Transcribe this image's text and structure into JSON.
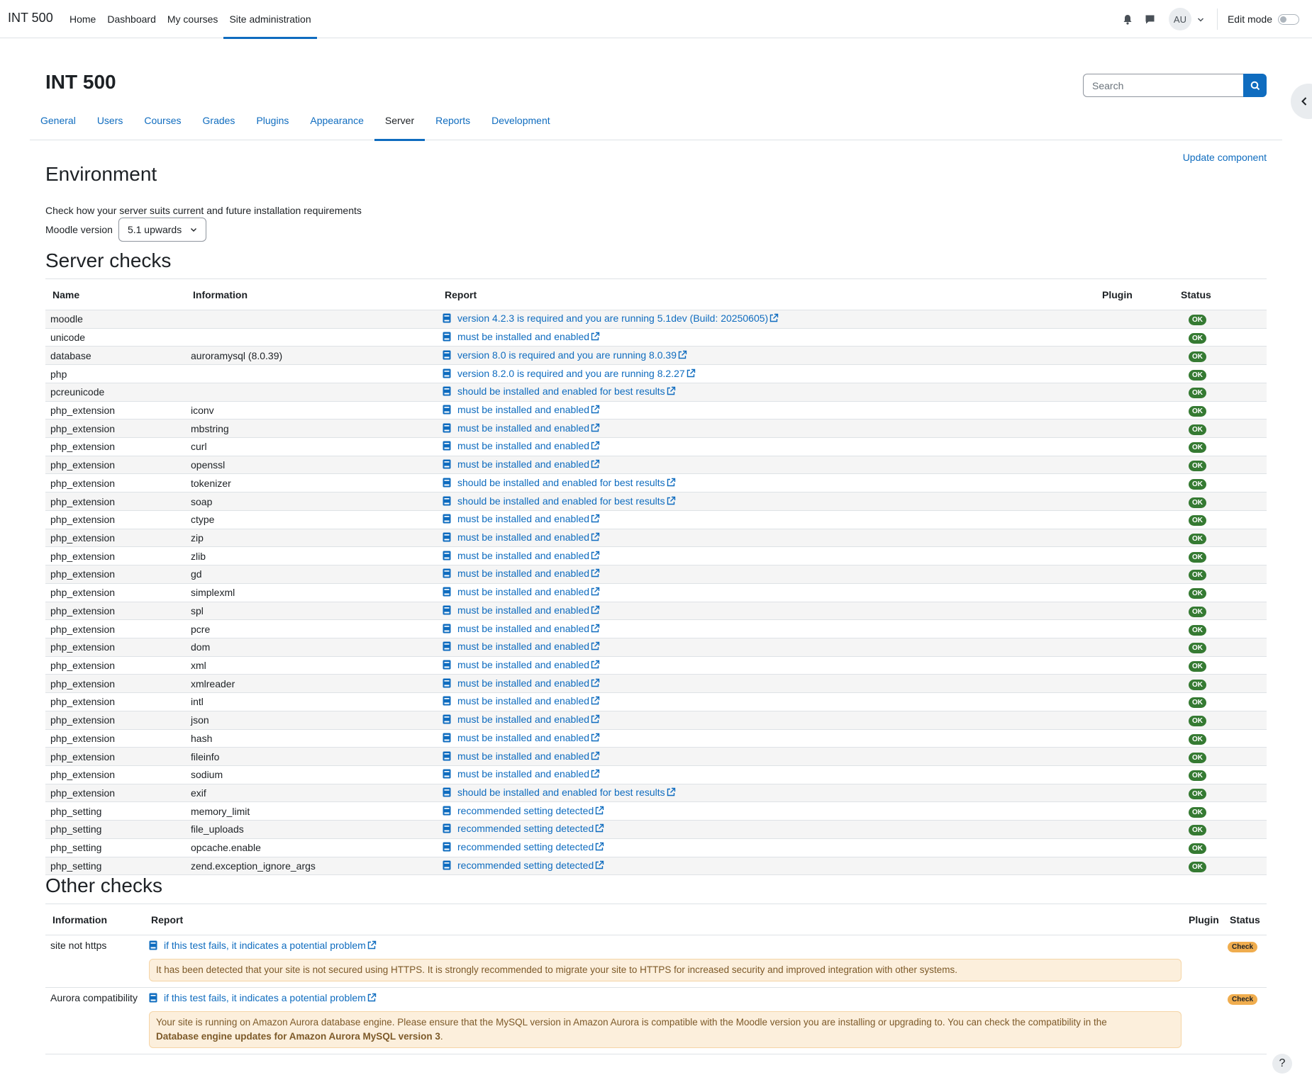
{
  "brand": "INT 500",
  "primary_nav": [
    "Home",
    "Dashboard",
    "My courses",
    "Site administration"
  ],
  "user_initials": "AU",
  "edit_mode_label": "Edit mode",
  "page_title": "INT 500",
  "search": {
    "placeholder": "Search"
  },
  "secondary_nav": [
    "General",
    "Users",
    "Courses",
    "Grades",
    "Plugins",
    "Appearance",
    "Server",
    "Reports",
    "Development"
  ],
  "active_secondary": "Server",
  "update_component": "Update component",
  "environment": {
    "heading": "Environment",
    "description": "Check how your server suits current and future installation requirements",
    "version_label": "Moodle version",
    "version_value": "5.1 upwards"
  },
  "server_checks": {
    "heading": "Server checks",
    "columns": [
      "Name",
      "Information",
      "Report",
      "Plugin",
      "Status"
    ],
    "rows": [
      {
        "name": "moodle",
        "info": "",
        "report": "version 4.2.3 is required and you are running 5.1dev (Build: 20250605)",
        "plugin": "",
        "status": "OK"
      },
      {
        "name": "unicode",
        "info": "",
        "report": "must be installed and enabled",
        "plugin": "",
        "status": "OK"
      },
      {
        "name": "database",
        "info": "auroramysql (8.0.39)",
        "report": "version 8.0 is required and you are running 8.0.39",
        "plugin": "",
        "status": "OK"
      },
      {
        "name": "php",
        "info": "",
        "report": "version 8.2.0 is required and you are running 8.2.27",
        "plugin": "",
        "status": "OK"
      },
      {
        "name": "pcreunicode",
        "info": "",
        "report": "should be installed and enabled for best results",
        "plugin": "",
        "status": "OK"
      },
      {
        "name": "php_extension",
        "info": "iconv",
        "report": "must be installed and enabled",
        "plugin": "",
        "status": "OK"
      },
      {
        "name": "php_extension",
        "info": "mbstring",
        "report": "must be installed and enabled",
        "plugin": "",
        "status": "OK"
      },
      {
        "name": "php_extension",
        "info": "curl",
        "report": "must be installed and enabled",
        "plugin": "",
        "status": "OK"
      },
      {
        "name": "php_extension",
        "info": "openssl",
        "report": "must be installed and enabled",
        "plugin": "",
        "status": "OK"
      },
      {
        "name": "php_extension",
        "info": "tokenizer",
        "report": "should be installed and enabled for best results",
        "plugin": "",
        "status": "OK"
      },
      {
        "name": "php_extension",
        "info": "soap",
        "report": "should be installed and enabled for best results",
        "plugin": "",
        "status": "OK"
      },
      {
        "name": "php_extension",
        "info": "ctype",
        "report": "must be installed and enabled",
        "plugin": "",
        "status": "OK"
      },
      {
        "name": "php_extension",
        "info": "zip",
        "report": "must be installed and enabled",
        "plugin": "",
        "status": "OK"
      },
      {
        "name": "php_extension",
        "info": "zlib",
        "report": "must be installed and enabled",
        "plugin": "",
        "status": "OK"
      },
      {
        "name": "php_extension",
        "info": "gd",
        "report": "must be installed and enabled",
        "plugin": "",
        "status": "OK"
      },
      {
        "name": "php_extension",
        "info": "simplexml",
        "report": "must be installed and enabled",
        "plugin": "",
        "status": "OK"
      },
      {
        "name": "php_extension",
        "info": "spl",
        "report": "must be installed and enabled",
        "plugin": "",
        "status": "OK"
      },
      {
        "name": "php_extension",
        "info": "pcre",
        "report": "must be installed and enabled",
        "plugin": "",
        "status": "OK"
      },
      {
        "name": "php_extension",
        "info": "dom",
        "report": "must be installed and enabled",
        "plugin": "",
        "status": "OK"
      },
      {
        "name": "php_extension",
        "info": "xml",
        "report": "must be installed and enabled",
        "plugin": "",
        "status": "OK"
      },
      {
        "name": "php_extension",
        "info": "xmlreader",
        "report": "must be installed and enabled",
        "plugin": "",
        "status": "OK"
      },
      {
        "name": "php_extension",
        "info": "intl",
        "report": "must be installed and enabled",
        "plugin": "",
        "status": "OK"
      },
      {
        "name": "php_extension",
        "info": "json",
        "report": "must be installed and enabled",
        "plugin": "",
        "status": "OK"
      },
      {
        "name": "php_extension",
        "info": "hash",
        "report": "must be installed and enabled",
        "plugin": "",
        "status": "OK"
      },
      {
        "name": "php_extension",
        "info": "fileinfo",
        "report": "must be installed and enabled",
        "plugin": "",
        "status": "OK"
      },
      {
        "name": "php_extension",
        "info": "sodium",
        "report": "must be installed and enabled",
        "plugin": "",
        "status": "OK"
      },
      {
        "name": "php_extension",
        "info": "exif",
        "report": "should be installed and enabled for best results",
        "plugin": "",
        "status": "OK"
      },
      {
        "name": "php_setting",
        "info": "memory_limit",
        "report": "recommended setting detected",
        "plugin": "",
        "status": "OK"
      },
      {
        "name": "php_setting",
        "info": "file_uploads",
        "report": "recommended setting detected",
        "plugin": "",
        "status": "OK"
      },
      {
        "name": "php_setting",
        "info": "opcache.enable",
        "report": "recommended setting detected",
        "plugin": "",
        "status": "OK"
      },
      {
        "name": "php_setting",
        "info": "zend.exception_ignore_args",
        "report": "recommended setting detected",
        "plugin": "",
        "status": "OK"
      }
    ]
  },
  "other_checks": {
    "heading": "Other checks",
    "columns": [
      "Information",
      "Report",
      "Plugin",
      "Status"
    ],
    "rows": [
      {
        "info": "site not https",
        "report": "if this test fails, it indicates a potential problem",
        "alert": "It has been detected that your site is not secured using HTTPS. It is strongly recommended to migrate your site to HTTPS for increased security and improved integration with other systems.",
        "alert_bold": "",
        "alert_tail": "",
        "status": "Check"
      },
      {
        "info": "Aurora compatibility",
        "report": "if this test fails, it indicates a potential problem",
        "alert": "Your site is running on Amazon Aurora database engine. Please ensure that the MySQL version in Amazon Aurora is compatible with the Moodle version you are installing or upgrading to. You can check the compatibility in the",
        "alert_bold": "Database engine updates for Amazon Aurora MySQL version 3",
        "alert_tail": ".",
        "status": "Check"
      }
    ]
  },
  "help_label": "?",
  "colors": {
    "accent": "#0f6cbf",
    "ok": "#357a32",
    "check": "#f0ad4e",
    "alert_bg": "#fcefdc"
  }
}
